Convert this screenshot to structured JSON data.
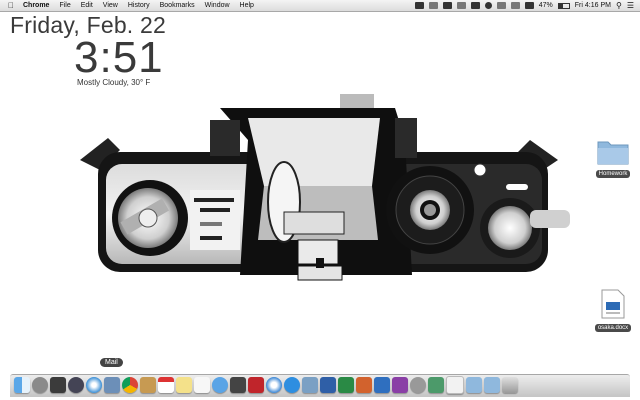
{
  "menubar": {
    "app_name": "Chrome",
    "menus": [
      "File",
      "Edit",
      "View",
      "History",
      "Bookmarks",
      "Window",
      "Help"
    ],
    "battery": "47%",
    "datetime": "Fri 4:16 PM"
  },
  "widget": {
    "date": "Friday, Feb. 22",
    "time": "3:51",
    "weather": "Mostly Cloudy, 30° F"
  },
  "desktop_icons": [
    {
      "label": "Homework",
      "type": "folder"
    },
    {
      "label": "osaka.docx",
      "type": "document"
    }
  ],
  "dock": {
    "tooltip": "Mail",
    "apps": [
      "finder",
      "launchpad",
      "mission-control",
      "dashboard",
      "safari",
      "mail",
      "chrome",
      "contacts",
      "calendar",
      "notes",
      "reminders",
      "messages",
      "facetime",
      "photo-booth",
      "itunes",
      "app-store",
      "preview",
      "word",
      "excel",
      "powerpoint",
      "outlook",
      "onenote",
      "system-preferences",
      "migration",
      "documents",
      "downloads",
      "applications",
      "trash"
    ]
  },
  "colors": {
    "menubar_bg": "#e6e6e6",
    "widget_text": "#3a3a3a",
    "folder_blue": "#8fb8dd"
  }
}
